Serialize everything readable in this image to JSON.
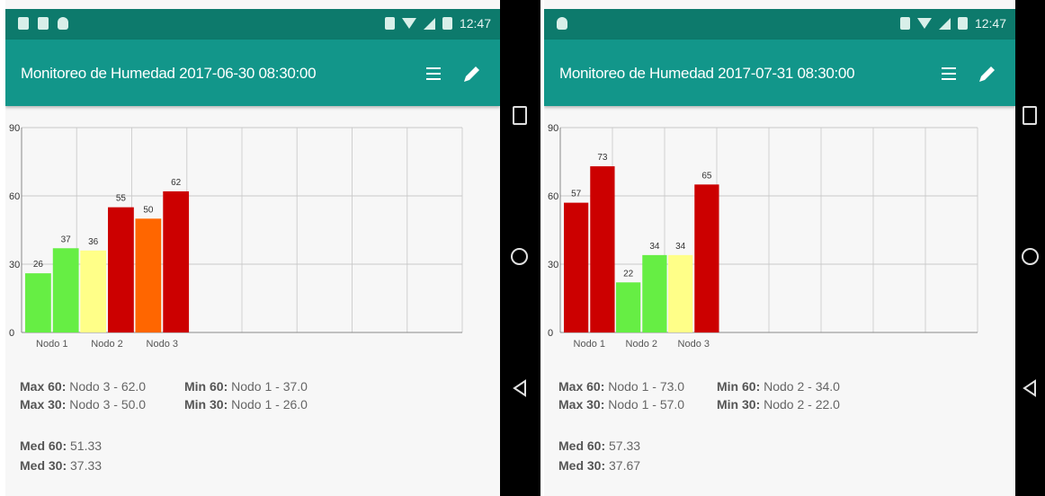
{
  "screens": [
    {
      "status_time": "12:47",
      "title": "Monitoreo de Humedad 2017-06-30 08:30:00",
      "chart_data": {
        "type": "bar",
        "categories": [
          "Nodo 1",
          "Nodo 2",
          "Nodo 3"
        ],
        "ylim": [
          0,
          90
        ],
        "yticks": [
          "0",
          "30",
          "60",
          "90"
        ],
        "bars": [
          {
            "category": "Nodo 1",
            "value": 26,
            "label": "26",
            "color": "#66ee44"
          },
          {
            "category": "Nodo 1",
            "value": 37,
            "label": "37",
            "color": "#66ee44"
          },
          {
            "category": "Nodo 2",
            "value": 36,
            "label": "36",
            "color": "#ffff88"
          },
          {
            "category": "Nodo 2",
            "value": 55,
            "label": "55",
            "color": "#cc0000"
          },
          {
            "category": "Nodo 3",
            "value": 50,
            "label": "50",
            "color": "#ff6600"
          },
          {
            "category": "Nodo 3",
            "value": 62,
            "label": "62",
            "color": "#cc0000"
          }
        ],
        "grid": true
      },
      "stats": {
        "max60_label": "Max 60:",
        "max60_value": "Nodo 3 - 62.0",
        "max30_label": "Max 30:",
        "max30_value": "Nodo 3 - 50.0",
        "min60_label": "Min 60:",
        "min60_value": "Nodo 1 - 37.0",
        "min30_label": "Min 30:",
        "min30_value": "Nodo 1 - 26.0",
        "med60_label": "Med 60:",
        "med60_value": "51.33",
        "med30_label": "Med 30:",
        "med30_value": "37.33"
      }
    },
    {
      "status_time": "12:47",
      "title": "Monitoreo de Humedad 2017-07-31 08:30:00",
      "chart_data": {
        "type": "bar",
        "categories": [
          "Nodo 1",
          "Nodo 2",
          "Nodo 3"
        ],
        "ylim": [
          0,
          90
        ],
        "yticks": [
          "0",
          "30",
          "60",
          "90"
        ],
        "bars": [
          {
            "category": "Nodo 1",
            "value": 57,
            "label": "57",
            "color": "#cc0000"
          },
          {
            "category": "Nodo 1",
            "value": 73,
            "label": "73",
            "color": "#cc0000"
          },
          {
            "category": "Nodo 2",
            "value": 22,
            "label": "22",
            "color": "#66ee44"
          },
          {
            "category": "Nodo 2",
            "value": 34,
            "label": "34",
            "color": "#66ee44"
          },
          {
            "category": "Nodo 3",
            "value": 34,
            "label": "34",
            "color": "#ffff88"
          },
          {
            "category": "Nodo 3",
            "value": 65,
            "label": "65",
            "color": "#cc0000"
          }
        ],
        "grid": true
      },
      "stats": {
        "max60_label": "Max 60:",
        "max60_value": "Nodo 1 - 73.0",
        "max30_label": "Max 30:",
        "max30_value": "Nodo 1 - 57.0",
        "min60_label": "Min 60:",
        "min60_value": "Nodo 2 - 34.0",
        "min30_label": "Min 30:",
        "min30_value": "Nodo 2 - 22.0",
        "med60_label": "Med 60:",
        "med60_value": "57.33",
        "med30_label": "Med 30:",
        "med30_value": "37.67"
      }
    }
  ],
  "icons": {
    "list": "list-icon",
    "edit": "pencil-icon",
    "nav_recents": "square-icon",
    "nav_home": "circle-icon",
    "nav_back": "triangle-back-icon"
  },
  "colors": {
    "status_bar": "#0d7a6c",
    "app_bar": "#12968a"
  }
}
